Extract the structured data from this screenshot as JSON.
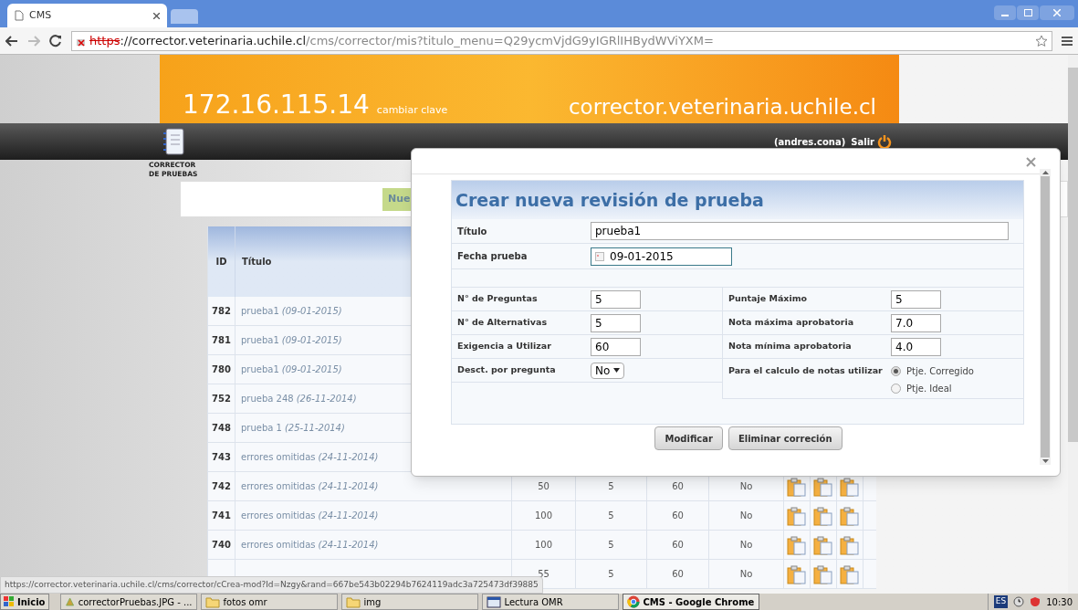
{
  "browser": {
    "tab": {
      "title": "CMS"
    },
    "url": {
      "scheme": "https",
      "host": "://corrector.veterinaria.uchile.cl",
      "path": "/cms/corrector/mis?titulo_menu=Q29ycmVjdG9yIGRlIHBydWViYXM="
    }
  },
  "header": {
    "ip": "172.16.115.14",
    "change_password": "cambiar clave",
    "site": "corrector.veterinaria.uchile.cl",
    "user": "(andres.cona)",
    "logout": "Salir",
    "app_name": "CORRECTOR DE PRUEBAS"
  },
  "new_button": "Nue",
  "table": {
    "columns": [
      "ID",
      "Título"
    ],
    "rows": [
      {
        "id": "782",
        "title": "prueba1",
        "date": "(09-01-2015)"
      },
      {
        "id": "781",
        "title": "prueba1",
        "date": "(09-01-2015)"
      },
      {
        "id": "780",
        "title": "prueba1",
        "date": "(09-01-2015)"
      },
      {
        "id": "752",
        "title": "prueba 248",
        "date": "(26-11-2014)"
      },
      {
        "id": "748",
        "title": "prueba 1",
        "date": "(25-11-2014)"
      },
      {
        "id": "743",
        "title": "errores omitidas",
        "date": "(24-11-2014)"
      },
      {
        "id": "742",
        "title": "errores omitidas",
        "date": "(24-11-2014)",
        "column_3": "50",
        "column_4": "5",
        "column_5": "60",
        "column_6": "No"
      },
      {
        "id": "741",
        "title": "errores omitidas",
        "date": "(24-11-2014)",
        "column_3": "100",
        "column_4": "5",
        "column_5": "60",
        "column_6": "No"
      },
      {
        "id": "740",
        "title": "errores omitidas",
        "date": "(24-11-2014)",
        "column_3": "100",
        "column_4": "5",
        "column_5": "60",
        "column_6": "No"
      },
      {
        "column_3": "55",
        "column_4": "5",
        "column_5": "60",
        "column_6": "No"
      }
    ]
  },
  "modal": {
    "title": "Crear nueva revisión de prueba",
    "titulo": {
      "label": "Título",
      "value": "prueba1"
    },
    "fecha": {
      "label": "Fecha prueba",
      "value": "09-01-2015"
    },
    "left_fields": [
      {
        "kind": "input",
        "label": "N° de Preguntas",
        "value": "5"
      },
      {
        "kind": "input",
        "label": "N° de Alternativas",
        "value": "5"
      },
      {
        "kind": "input",
        "label": "Exigencia a Utilizar",
        "value": "60"
      },
      {
        "kind": "select",
        "label": "Desct. por pregunta",
        "value": "No"
      }
    ],
    "right_fields": [
      {
        "kind": "input",
        "label": "Puntaje Máximo",
        "value": "5"
      },
      {
        "kind": "input",
        "label": "Nota máxima aprobatoria",
        "value": "7.0"
      },
      {
        "kind": "input",
        "label": "Nota mínima aprobatoria",
        "value": "4.0"
      },
      {
        "kind": "radio",
        "label": "Para el calculo de notas utilizar",
        "options": [
          {
            "label": "Ptje. Corregido",
            "selected": true
          },
          {
            "label": "Ptje. Ideal",
            "selected": false
          }
        ]
      }
    ],
    "buttons": [
      "Modificar",
      "Eliminar correción"
    ]
  },
  "status_url": "https://corrector.veterinaria.uchile.cl/cms/corrector/cCrea-mod?Id=Nzgy&rand=667be543b02294b7624119adc3a725473df39885",
  "taskbar": {
    "start": "Inicio",
    "items": [
      {
        "label": "correctorPruebas.JPG - ...",
        "kind": "image",
        "selected": false
      },
      {
        "label": "fotos omr",
        "kind": "folder",
        "selected": false
      },
      {
        "label": "img",
        "kind": "folder",
        "selected": false
      },
      {
        "label": "Lectura OMR",
        "kind": "window",
        "selected": false
      },
      {
        "label": "CMS - Google Chrome",
        "kind": "browser",
        "selected": true
      }
    ],
    "language": "ES",
    "time": "10:30"
  }
}
